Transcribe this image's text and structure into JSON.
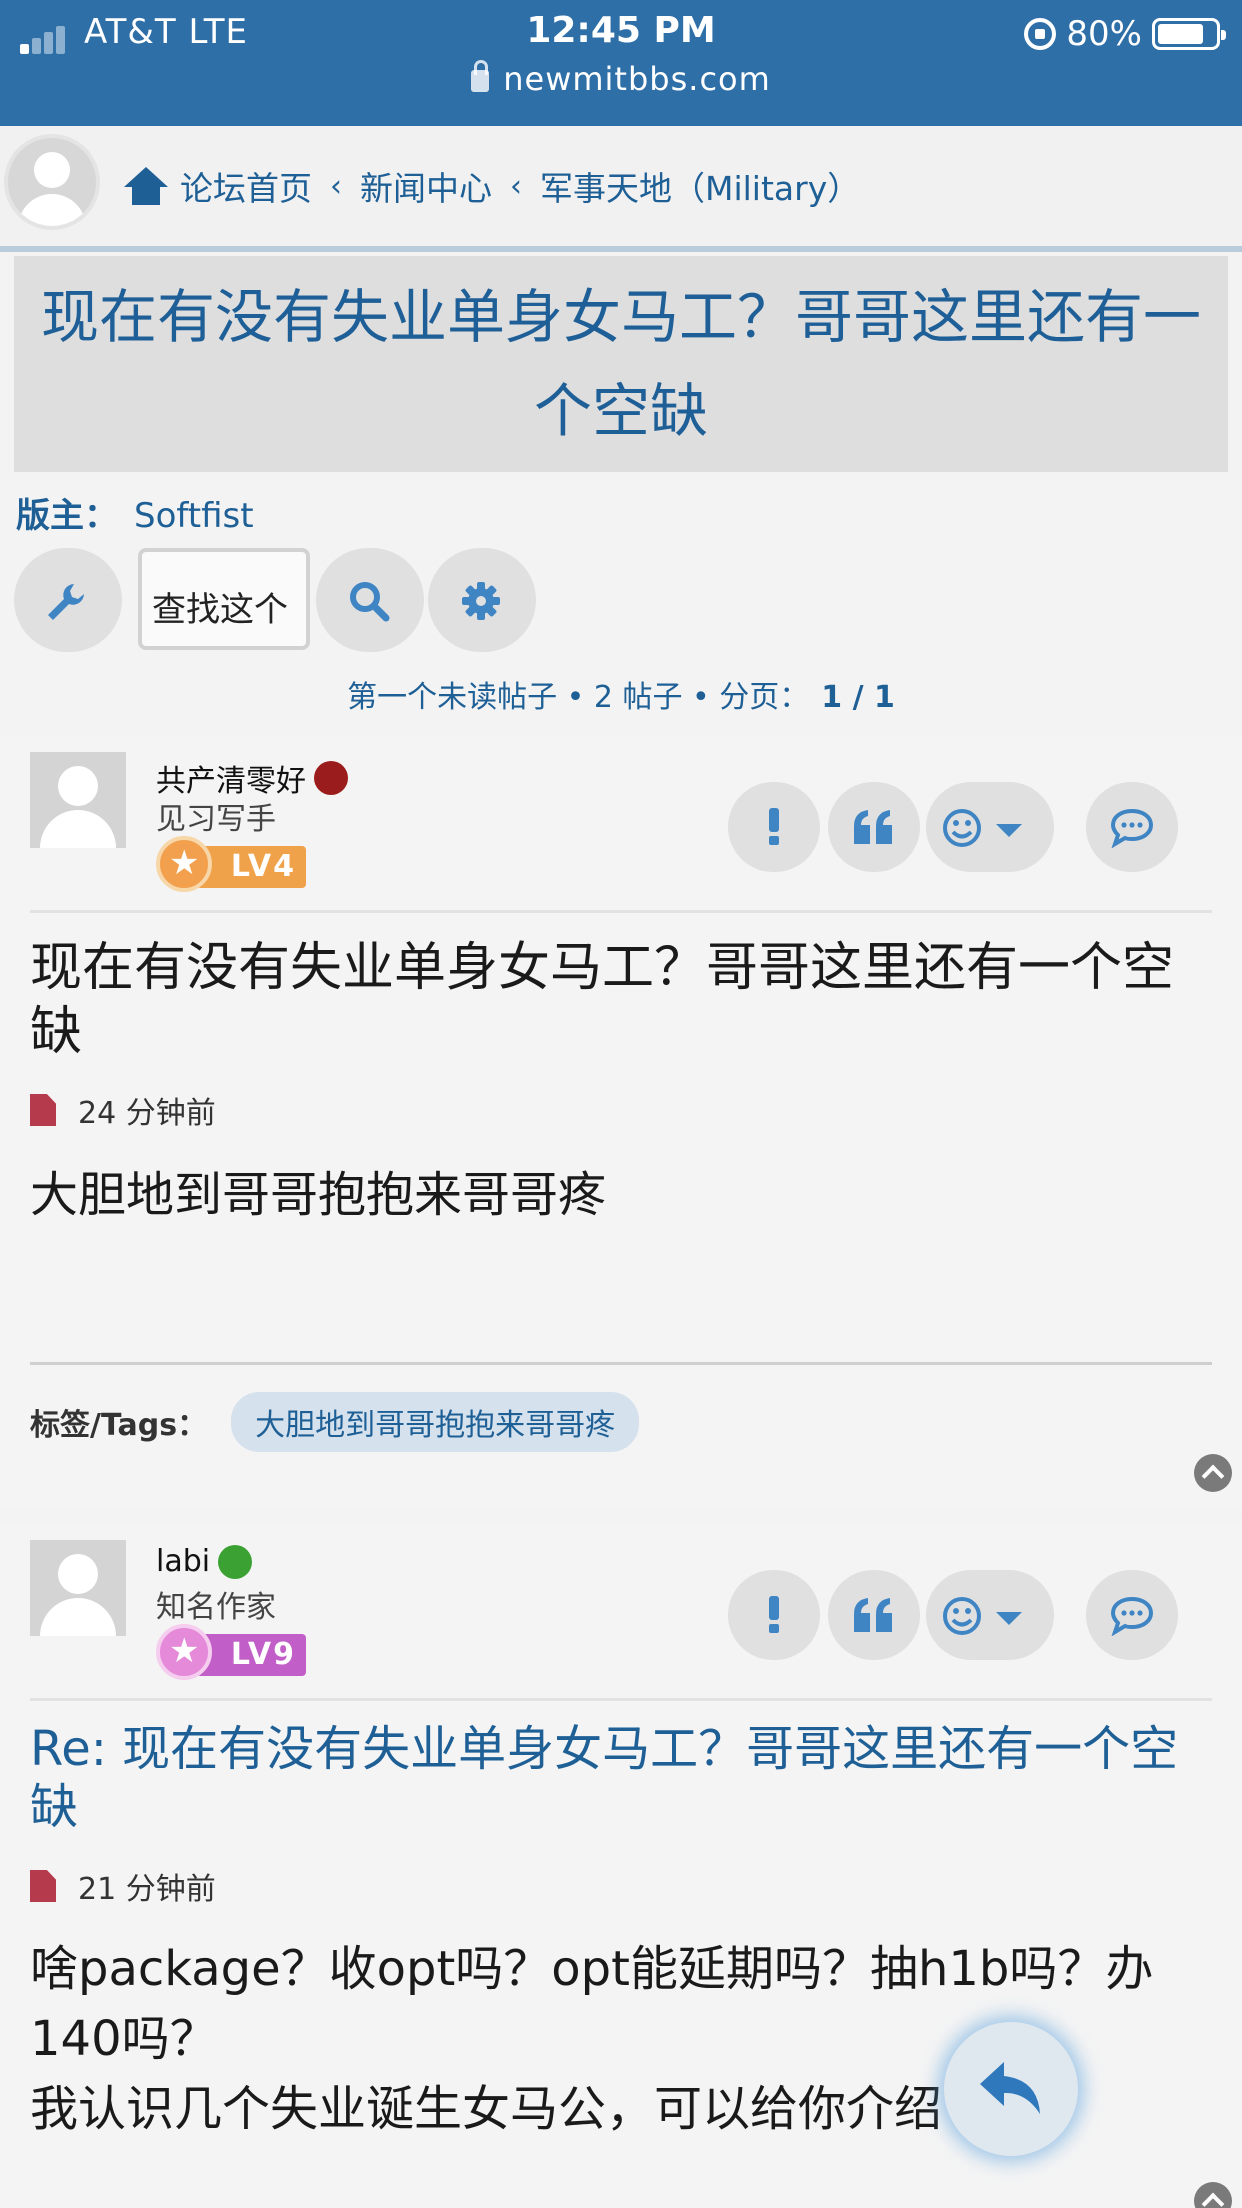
{
  "status_bar": {
    "carrier": "AT&T  LTE",
    "time": "12:45 PM",
    "battery": "80%",
    "battery_level": 0.8,
    "url": "newmitbbs.com"
  },
  "breadcrumb": {
    "items": [
      "论坛首页",
      "新闻中心",
      "军事天地（Military）"
    ]
  },
  "topic": {
    "title": "现在有没有失业单身女马工？哥哥这里还有一个空缺",
    "moderator_label": "版主：",
    "moderator": "Softfist"
  },
  "toolbar": {
    "search_placeholder": "查找这个"
  },
  "pagination": {
    "text": "第一个未读帖子 • 2 帖子 • 分页：",
    "pages": "1 / 1"
  },
  "posts": [
    {
      "author": "共产清零好",
      "status_color": "#9b1c1c",
      "rank": "见习写手",
      "level": "LV4",
      "level_color": "#f0a24a",
      "title": "现在有没有失业单身女马工？哥哥这里还有一个空缺",
      "time": "24 分钟前",
      "content": "大胆地到哥哥抱抱来哥哥疼",
      "tags_label": "标签/Tags：",
      "tags": [
        "大胆地到哥哥抱抱来哥哥疼"
      ]
    },
    {
      "author": "labi",
      "status_color": "#3aa132",
      "rank": "知名作家",
      "level": "LV9",
      "level_color": "#c25ec7",
      "title": "Re: 现在有没有失业单身女马工？哥哥这里还有一个空缺",
      "time": "21 分钟前",
      "content_line1": "啥package？收opt吗？opt能延期吗？抽h1b吗？办140吗？",
      "content_line2": "我认识几个失业诞生女马公，可以给你介绍"
    }
  ],
  "icons": {
    "signal": "signal-bars-icon",
    "lock": "lock-icon",
    "home": "home-icon",
    "wrench": "wrench-icon",
    "search": "search-icon",
    "gear": "gear-icon",
    "report": "exclamation-icon",
    "quote": "quote-icon",
    "reaction": "smiley-icon",
    "comment": "comment-bubble-icon",
    "file": "file-icon",
    "top": "scroll-top-icon",
    "reply": "reply-arrow-icon"
  },
  "colors": {
    "accent": "#1e5f96",
    "status_bar": "#2f6fa8"
  }
}
